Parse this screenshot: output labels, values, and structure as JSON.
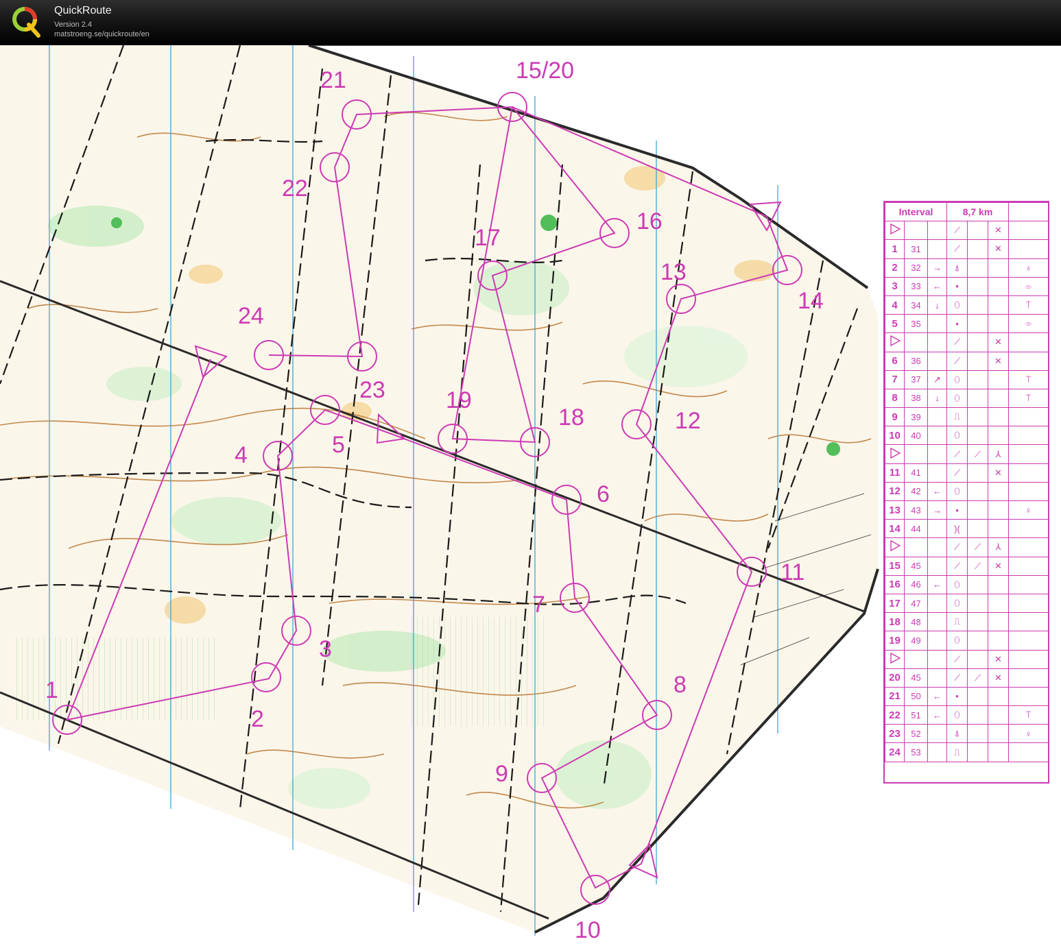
{
  "header": {
    "app_name": "QuickRoute",
    "version": "Version 2.4",
    "url": "matstroeng.se/quickroute/en",
    "logo_letter": "Q"
  },
  "map": {
    "course_color": "#cc3ab4",
    "control_labels": [
      "1",
      "2",
      "3",
      "4",
      "5",
      "6",
      "7",
      "8",
      "9",
      "10",
      "11",
      "12",
      "13",
      "14",
      "15/20",
      "16",
      "17",
      "18",
      "19",
      "21",
      "22",
      "23",
      "24"
    ]
  },
  "description_sheet": {
    "header": {
      "course": "Interval",
      "length": "8,7 km"
    },
    "rows": [
      {
        "num": "start-icon",
        "code": "",
        "dir": "",
        "feature": "⟋",
        "appearance": "",
        "detail": "✕",
        "extra": ""
      },
      {
        "num": "1",
        "code": "31",
        "dir": "",
        "feature": "⟋",
        "appearance": "",
        "detail": "✕",
        "extra": ""
      },
      {
        "num": "2",
        "code": "32",
        "dir": "→",
        "feature": "⍋",
        "appearance": "",
        "detail": "",
        "extra": "♁"
      },
      {
        "num": "3",
        "code": "33",
        "dir": "←",
        "feature": "•",
        "appearance": "",
        "detail": "",
        "extra": "⌯"
      },
      {
        "num": "4",
        "code": "34",
        "dir": "↓",
        "feature": "⬯",
        "appearance": "",
        "detail": "",
        "extra": "⍑"
      },
      {
        "num": "5",
        "code": "35",
        "dir": "",
        "feature": "•",
        "appearance": "",
        "detail": "",
        "extra": "⌯"
      },
      {
        "num": "start-icon",
        "code": "",
        "dir": "",
        "feature": "⟋",
        "appearance": "",
        "detail": "✕",
        "extra": ""
      },
      {
        "num": "6",
        "code": "36",
        "dir": "",
        "feature": "⟋",
        "appearance": "",
        "detail": "✕",
        "extra": ""
      },
      {
        "num": "7",
        "code": "37",
        "dir": "↗",
        "feature": "⬯",
        "appearance": "",
        "detail": "",
        "extra": "⍑"
      },
      {
        "num": "8",
        "code": "38",
        "dir": "↓",
        "feature": "⬯",
        "appearance": "",
        "detail": "",
        "extra": "⍑"
      },
      {
        "num": "9",
        "code": "39",
        "dir": "",
        "feature": "⎍",
        "appearance": "",
        "detail": "",
        "extra": ""
      },
      {
        "num": "10",
        "code": "40",
        "dir": "",
        "feature": "⬯",
        "appearance": "",
        "detail": "",
        "extra": ""
      },
      {
        "num": "start-icon",
        "code": "",
        "dir": "",
        "feature": "⟋",
        "appearance": "⟋",
        "detail": "⅄",
        "extra": ""
      },
      {
        "num": "11",
        "code": "41",
        "dir": "",
        "feature": "⟋",
        "appearance": "",
        "detail": "✕",
        "extra": ""
      },
      {
        "num": "12",
        "code": "42",
        "dir": "←",
        "feature": "⬯",
        "appearance": "",
        "detail": "",
        "extra": ""
      },
      {
        "num": "13",
        "code": "43",
        "dir": "→",
        "feature": "•",
        "appearance": "",
        "detail": "",
        "extra": "♀"
      },
      {
        "num": "14",
        "code": "44",
        "dir": "",
        "feature": ")(",
        "appearance": "",
        "detail": "",
        "extra": ""
      },
      {
        "num": "start-icon",
        "code": "",
        "dir": "",
        "feature": "⟋",
        "appearance": "⟋",
        "detail": "⅄",
        "extra": ""
      },
      {
        "num": "15",
        "code": "45",
        "dir": "",
        "feature": "⟋",
        "appearance": "⟋",
        "detail": "✕",
        "extra": ""
      },
      {
        "num": "16",
        "code": "46",
        "dir": "←",
        "feature": "⬯",
        "appearance": "",
        "detail": "",
        "extra": ""
      },
      {
        "num": "17",
        "code": "47",
        "dir": "",
        "feature": "⬯",
        "appearance": "",
        "detail": "",
        "extra": ""
      },
      {
        "num": "18",
        "code": "48",
        "dir": "",
        "feature": "⎍",
        "appearance": "",
        "detail": "",
        "extra": ""
      },
      {
        "num": "19",
        "code": "49",
        "dir": "",
        "feature": "⬯",
        "appearance": "",
        "detail": "",
        "extra": ""
      },
      {
        "num": "start-icon",
        "code": "",
        "dir": "",
        "feature": "⟋",
        "appearance": "",
        "detail": "✕",
        "extra": ""
      },
      {
        "num": "20",
        "code": "45",
        "dir": "",
        "feature": "⟋",
        "appearance": "⟋",
        "detail": "✕",
        "extra": ""
      },
      {
        "num": "21",
        "code": "50",
        "dir": "←",
        "feature": "•",
        "appearance": "",
        "detail": "",
        "extra": ""
      },
      {
        "num": "22",
        "code": "51",
        "dir": "←",
        "feature": "⬯",
        "appearance": "",
        "detail": "",
        "extra": "⍑"
      },
      {
        "num": "23",
        "code": "52",
        "dir": "",
        "feature": "⍋",
        "appearance": "",
        "detail": "",
        "extra": "♀"
      },
      {
        "num": "24",
        "code": "53",
        "dir": "",
        "feature": "⎍",
        "appearance": "",
        "detail": "",
        "extra": ""
      }
    ]
  }
}
